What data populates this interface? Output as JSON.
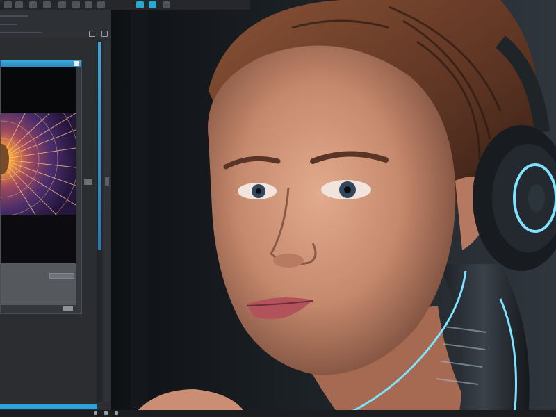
{
  "image": {
    "subject": "woman-cyborg-portrait",
    "colors": {
      "background": "#1b1e23",
      "panel": "#2b2d31",
      "accent": "#2aa7d8",
      "glow": "#7fe3ff",
      "hair": "#6b3e2a",
      "skin": "#c98e74"
    }
  },
  "editor_ui": {
    "toolbar_icons": [
      "cursor-icon",
      "square-icon",
      "grid-icon",
      "frame-icon",
      "image-icon",
      "ruler-icon",
      "stop-icon",
      "play-icon",
      "save-icon",
      "export-icon"
    ]
  }
}
